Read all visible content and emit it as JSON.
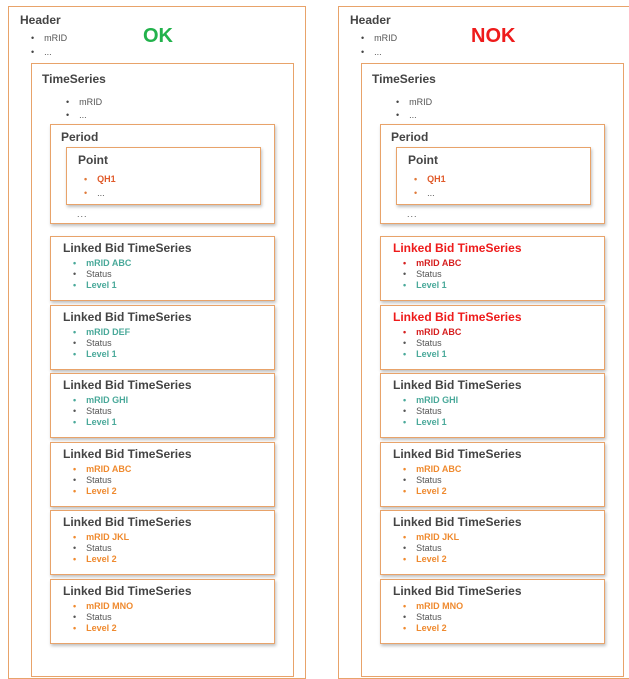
{
  "colors": {
    "border": "#e8a36a",
    "ok": "#22b24c",
    "nok": "#ee1b1b",
    "teal": "#4aa99a",
    "orange": "#ef8a2f",
    "red_item": "#d62020"
  },
  "panels": [
    {
      "verdict": "OK",
      "verdict_color": "ok",
      "header": {
        "title": "Header",
        "items": [
          "mRID",
          "..."
        ]
      },
      "timeseries": {
        "title": "TimeSeries",
        "items": [
          "mRID",
          "..."
        ],
        "period": {
          "title": "Period",
          "dots": "...",
          "point": {
            "title": "Point",
            "items": [
              "QH1",
              "..."
            ]
          }
        }
      },
      "linked": [
        {
          "title": "Linked Bid TimeSeries",
          "title_style": "normal",
          "mrid": "mRID ABC",
          "status": "Status",
          "level": "Level 1",
          "color": "teal"
        },
        {
          "title": "Linked Bid TimeSeries",
          "title_style": "normal",
          "mrid": "mRID DEF",
          "status": "Status",
          "level": "Level 1",
          "color": "teal"
        },
        {
          "title": "Linked Bid TimeSeries",
          "title_style": "normal",
          "mrid": "mRID GHI",
          "status": "Status",
          "level": "Level 1",
          "color": "teal"
        },
        {
          "title": "Linked Bid TimeSeries",
          "title_style": "normal",
          "mrid": "mRID ABC",
          "status": "Status",
          "level": "Level 2",
          "color": "orange"
        },
        {
          "title": "Linked Bid TimeSeries",
          "title_style": "normal",
          "mrid": "mRID JKL",
          "status": "Status",
          "level": "Level 2",
          "color": "orange"
        },
        {
          "title": "Linked Bid TimeSeries",
          "title_style": "normal",
          "mrid": "mRID MNO",
          "status": "Status",
          "level": "Level 2",
          "color": "orange"
        }
      ]
    },
    {
      "verdict": "NOK",
      "verdict_color": "nok",
      "header": {
        "title": "Header",
        "items": [
          "mRID",
          "..."
        ]
      },
      "timeseries": {
        "title": "TimeSeries",
        "items": [
          "mRID",
          "..."
        ],
        "period": {
          "title": "Period",
          "dots": "...",
          "point": {
            "title": "Point",
            "items": [
              "QH1",
              "..."
            ]
          }
        }
      },
      "linked": [
        {
          "title": "Linked Bid TimeSeries",
          "title_style": "red",
          "mrid": "mRID ABC",
          "status": "Status",
          "level": "Level 1",
          "color": "red_teal"
        },
        {
          "title": "Linked Bid TimeSeries",
          "title_style": "red",
          "mrid": "mRID ABC",
          "status": "Status",
          "level": "Level 1",
          "color": "red_teal"
        },
        {
          "title": "Linked Bid TimeSeries",
          "title_style": "normal",
          "mrid": "mRID GHI",
          "status": "Status",
          "level": "Level 1",
          "color": "teal"
        },
        {
          "title": "Linked Bid TimeSeries",
          "title_style": "normal",
          "mrid": "mRID ABC",
          "status": "Status",
          "level": "Level 2",
          "color": "orange"
        },
        {
          "title": "Linked Bid TimeSeries",
          "title_style": "normal",
          "mrid": "mRID JKL",
          "status": "Status",
          "level": "Level 2",
          "color": "orange"
        },
        {
          "title": "Linked Bid TimeSeries",
          "title_style": "normal",
          "mrid": "mRID MNO",
          "status": "Status",
          "level": "Level 2",
          "color": "orange"
        }
      ]
    }
  ]
}
